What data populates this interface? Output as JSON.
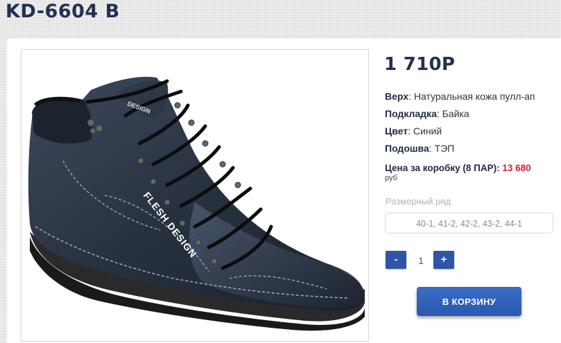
{
  "page": {
    "title": "KD-6604 B"
  },
  "product": {
    "image_alt": "Ботинок FLESH DESIGN",
    "brand_mark": "FLESH DESIGN",
    "tongue_mark": "DESIGN",
    "price": "1 710Р",
    "specs": [
      {
        "label": "Верх",
        "value": ": Натуральная кожа пулл-ап"
      },
      {
        "label": "Подкладка",
        "value": ": Байка"
      },
      {
        "label": "Цвет",
        "value": ": Синий"
      },
      {
        "label": "Подошва",
        "value": ": ТЭП"
      }
    ],
    "box_price_label": "Цена за коробку (8 ПАР):",
    "box_price_value": "13 680",
    "box_price_unit": "руб",
    "size_label": "Размерный ряд",
    "size_value": "40-1, 41-2, 42-2, 43-2, 44-1"
  },
  "quantity": {
    "minus": "-",
    "value": "1",
    "plus": "+"
  },
  "cart": {
    "label": "В КОРЗИНУ"
  },
  "colors": {
    "accent": "#2d56a6",
    "price_red": "#d6202a",
    "title": "#233052"
  }
}
